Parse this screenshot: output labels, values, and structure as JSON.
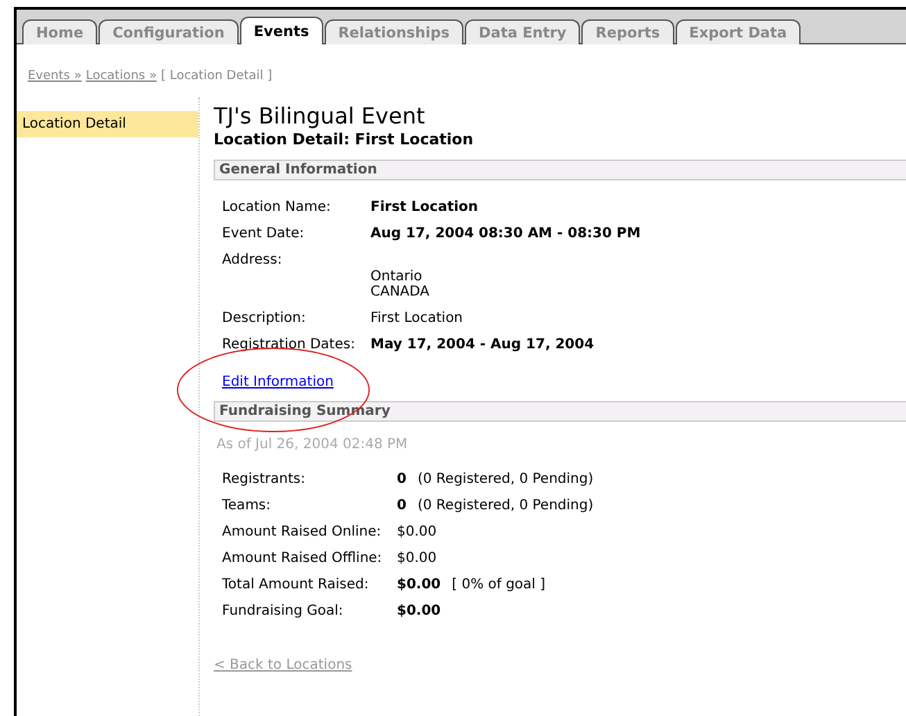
{
  "tabs": [
    {
      "label": "Home",
      "selected": false
    },
    {
      "label": "Configuration",
      "selected": false
    },
    {
      "label": "Events",
      "selected": true
    },
    {
      "label": "Relationships",
      "selected": false
    },
    {
      "label": "Data Entry",
      "selected": false
    },
    {
      "label": "Reports",
      "selected": false
    },
    {
      "label": "Export Data",
      "selected": false
    }
  ],
  "breadcrumb": {
    "links": [
      "Events »",
      "Locations »"
    ],
    "current": "[ Location Detail ]"
  },
  "sidebar": {
    "items": [
      {
        "label": "Location Detail",
        "selected": true
      }
    ]
  },
  "title": "TJ's Bilingual Event",
  "subtitle": "Location Detail: First Location",
  "general": {
    "heading": "General Information",
    "rows": [
      {
        "label": "Location Name:",
        "lines": [
          "First Location"
        ],
        "strong": true
      },
      {
        "label": "Event Date:",
        "lines": [
          "Aug 17, 2004 08:30 AM - 08:30 PM"
        ],
        "strong": true
      },
      {
        "label": "Address:",
        "lines": [
          "Ontario",
          "CANADA"
        ],
        "strong": false
      },
      {
        "label": "Description:",
        "lines": [
          "First Location"
        ],
        "strong": false
      },
      {
        "label": "Registration Dates:",
        "lines": [
          "May 17, 2004 - Aug 17, 2004"
        ],
        "strong": true
      }
    ],
    "edit_link": "Edit Information"
  },
  "fundraising": {
    "heading": "Fundraising Summary",
    "as_of": "As of Jul 26, 2004 02:48 PM",
    "rows": [
      {
        "label": "Registrants:",
        "value": "0",
        "strong": true,
        "note": "(0 Registered, 0 Pending)"
      },
      {
        "label": "Teams:",
        "value": "0",
        "strong": true,
        "note": "(0 Registered, 0 Pending)"
      },
      {
        "label": "Amount Raised Online:",
        "value": "$0.00",
        "strong": false
      },
      {
        "label": "Amount Raised Offline:",
        "value": "$0.00",
        "strong": false
      },
      {
        "label": "Total Amount Raised:",
        "value": "$0.00",
        "strong": true,
        "note": "[ 0% of goal ]"
      },
      {
        "label": "Fundraising Goal:",
        "value": "$0.00",
        "strong": true
      }
    ]
  },
  "back_link": "< Back to Locations"
}
